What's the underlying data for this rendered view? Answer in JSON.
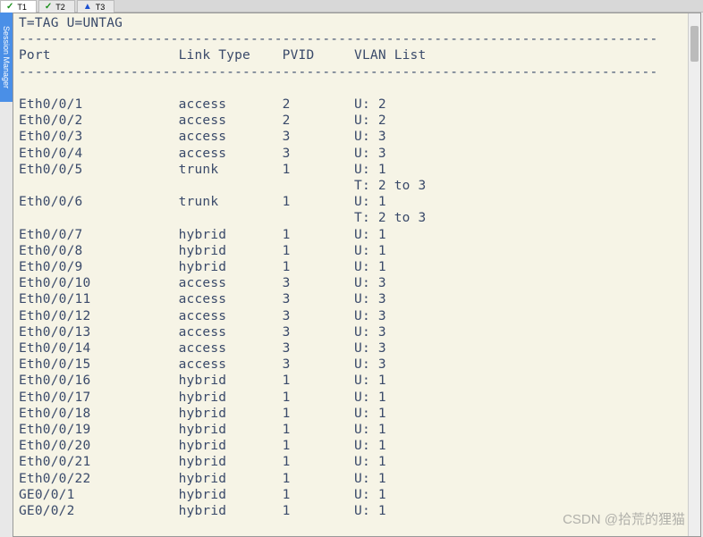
{
  "tabs": [
    {
      "label": "T1",
      "status": "ok",
      "active": true
    },
    {
      "label": "T2",
      "status": "ok",
      "active": false
    },
    {
      "label": "T3",
      "status": "warn",
      "active": false
    }
  ],
  "sessionManagerLabel": "Session Manager",
  "watermark": "CSDN @拾荒的狸猫",
  "terminal": {
    "legend": "T=TAG U=UNTAG",
    "divider": "--------------------------------------------------------------------------------",
    "headers": {
      "port": "Port",
      "link": "Link Type",
      "pvid": "PVID",
      "vlan": "VLAN List"
    },
    "rows": [
      {
        "port": "Eth0/0/1",
        "link": "access",
        "pvid": "2",
        "vlan": [
          "U: 2"
        ]
      },
      {
        "port": "Eth0/0/2",
        "link": "access",
        "pvid": "2",
        "vlan": [
          "U: 2"
        ]
      },
      {
        "port": "Eth0/0/3",
        "link": "access",
        "pvid": "3",
        "vlan": [
          "U: 3"
        ]
      },
      {
        "port": "Eth0/0/4",
        "link": "access",
        "pvid": "3",
        "vlan": [
          "U: 3"
        ]
      },
      {
        "port": "Eth0/0/5",
        "link": "trunk",
        "pvid": "1",
        "vlan": [
          "U: 1",
          "T: 2 to 3"
        ]
      },
      {
        "port": "Eth0/0/6",
        "link": "trunk",
        "pvid": "1",
        "vlan": [
          "U: 1",
          "T: 2 to 3"
        ]
      },
      {
        "port": "Eth0/0/7",
        "link": "hybrid",
        "pvid": "1",
        "vlan": [
          "U: 1"
        ]
      },
      {
        "port": "Eth0/0/8",
        "link": "hybrid",
        "pvid": "1",
        "vlan": [
          "U: 1"
        ]
      },
      {
        "port": "Eth0/0/9",
        "link": "hybrid",
        "pvid": "1",
        "vlan": [
          "U: 1"
        ]
      },
      {
        "port": "Eth0/0/10",
        "link": "access",
        "pvid": "3",
        "vlan": [
          "U: 3"
        ]
      },
      {
        "port": "Eth0/0/11",
        "link": "access",
        "pvid": "3",
        "vlan": [
          "U: 3"
        ]
      },
      {
        "port": "Eth0/0/12",
        "link": "access",
        "pvid": "3",
        "vlan": [
          "U: 3"
        ]
      },
      {
        "port": "Eth0/0/13",
        "link": "access",
        "pvid": "3",
        "vlan": [
          "U: 3"
        ]
      },
      {
        "port": "Eth0/0/14",
        "link": "access",
        "pvid": "3",
        "vlan": [
          "U: 3"
        ]
      },
      {
        "port": "Eth0/0/15",
        "link": "access",
        "pvid": "3",
        "vlan": [
          "U: 3"
        ]
      },
      {
        "port": "Eth0/0/16",
        "link": "hybrid",
        "pvid": "1",
        "vlan": [
          "U: 1"
        ]
      },
      {
        "port": "Eth0/0/17",
        "link": "hybrid",
        "pvid": "1",
        "vlan": [
          "U: 1"
        ]
      },
      {
        "port": "Eth0/0/18",
        "link": "hybrid",
        "pvid": "1",
        "vlan": [
          "U: 1"
        ]
      },
      {
        "port": "Eth0/0/19",
        "link": "hybrid",
        "pvid": "1",
        "vlan": [
          "U: 1"
        ]
      },
      {
        "port": "Eth0/0/20",
        "link": "hybrid",
        "pvid": "1",
        "vlan": [
          "U: 1"
        ]
      },
      {
        "port": "Eth0/0/21",
        "link": "hybrid",
        "pvid": "1",
        "vlan": [
          "U: 1"
        ]
      },
      {
        "port": "Eth0/0/22",
        "link": "hybrid",
        "pvid": "1",
        "vlan": [
          "U: 1"
        ]
      },
      {
        "port": "GE0/0/1",
        "link": "hybrid",
        "pvid": "1",
        "vlan": [
          "U: 1"
        ]
      },
      {
        "port": "GE0/0/2",
        "link": "hybrid",
        "pvid": "1",
        "vlan": [
          "U: 1"
        ]
      }
    ]
  }
}
